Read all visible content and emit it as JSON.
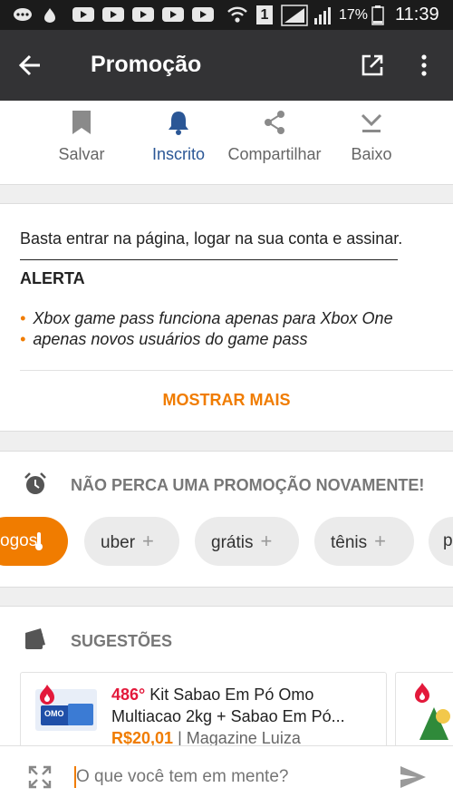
{
  "status": {
    "battery": "17%",
    "time": "11:39",
    "sim": "1"
  },
  "appbar": {
    "title": "Promoção"
  },
  "actions": [
    {
      "label": "Salvar"
    },
    {
      "label": "Inscrito"
    },
    {
      "label": "Compartilhar"
    },
    {
      "label": "Baixo"
    }
  ],
  "description": {
    "text": "Basta entrar na página, logar na sua conta e assinar.",
    "alert_title": "ALERTA",
    "bullets": [
      "Xbox game pass funciona apenas para Xbox One",
      "apenas novos usuários do game pass"
    ],
    "show_more": "MOSTRAR MAIS"
  },
  "alerts": {
    "title": "NÃO PERCA UMA PROMOÇÃO NOVAMENTE!",
    "chips": [
      "ogos",
      "uber",
      "grátis",
      "tênis",
      "p"
    ]
  },
  "suggestions": {
    "title": "SUGESTÕES",
    "items": [
      {
        "temp": "486°",
        "title_line1": "Kit Sabao Em Pó Omo",
        "title_line2": "Multiacao 2kg + Sabao Em Pó...",
        "price": "R$20,01",
        "store": "Magazine Luiza"
      }
    ]
  },
  "composer": {
    "placeholder": "O que você tem em mente?"
  },
  "colors": {
    "accent": "#f07c00",
    "active": "#2b5796",
    "appbar": "#333335",
    "hot": "#e3193b"
  }
}
